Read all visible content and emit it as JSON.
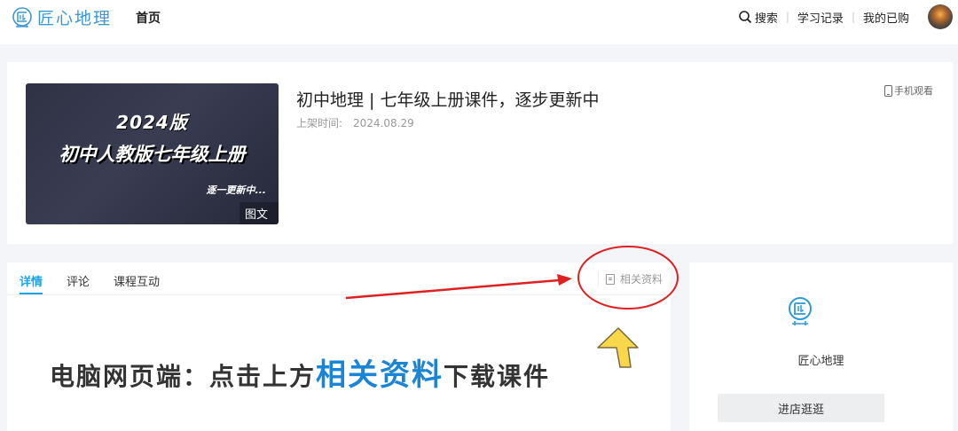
{
  "header": {
    "brand": "匠心地理",
    "nav_home": "首页",
    "search_label": "搜索",
    "study_record": "学习记录",
    "my_purchases": "我的已购"
  },
  "course": {
    "title": "初中地理 | 七年级上册课件，逐步更新中",
    "date_label": "上架时间:",
    "date_value": "2024.08.29",
    "mobile_watch": "手机观看",
    "cover": {
      "year": "2024版",
      "title": "初中人教版七年级上册",
      "subtitle": "逐一更新中...",
      "badge": "图文"
    }
  },
  "detail": {
    "tabs": [
      "详情",
      "评论",
      "课程互动"
    ],
    "active_tab": "详情",
    "related_label": "相关资料",
    "banner_prefix": "电脑网页端：点击上方",
    "banner_highlight": "相关资料",
    "banner_suffix": "下载课件"
  },
  "shop": {
    "name": "匠心地理",
    "enter_button": "进店逛逛"
  },
  "colors": {
    "brand_blue": "#3c98d4",
    "tab_active": "#1aa4e6",
    "annotation_red": "#e02020",
    "annotation_arrow_yellow": "#f8d84a"
  },
  "icons": {
    "logo": "compass-circle-icon",
    "search": "search-icon",
    "phone": "phone-icon",
    "related": "document-icon"
  }
}
